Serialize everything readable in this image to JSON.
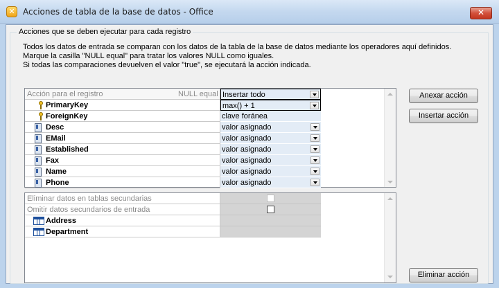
{
  "window": {
    "title": "Acciones de tabla de la base de datos - Office",
    "icon": "app-icon",
    "close_label": "✕"
  },
  "group": {
    "title": "Acciones que se deben ejecutar para cada registro",
    "description": [
      "Todos los datos de entrada se comparan con los datos de la tabla de la base de datos mediante los operadores aquí definidos.",
      "Marque la casilla \"NULL equal\" para tratar los valores NULL como iguales.",
      "Si todas las comparaciones devuelven el valor \"true\", se ejecutará la acción indicada."
    ]
  },
  "action_grid": {
    "header": {
      "label": "Acción para el registro",
      "null_equal": "NULL equal",
      "action_value": "Insertar todo"
    },
    "rows": [
      {
        "icon": "key-icon",
        "name": "PrimaryKey",
        "value": "max() + 1",
        "dropdown": true
      },
      {
        "icon": "key-icon",
        "name": "ForeignKey",
        "value": "clave foránea",
        "dropdown": false
      },
      {
        "icon": "field-icon",
        "name": "Desc",
        "value": "valor asignado",
        "dropdown": true
      },
      {
        "icon": "field-icon",
        "name": "EMail",
        "value": "valor asignado",
        "dropdown": true
      },
      {
        "icon": "field-icon",
        "name": "Established",
        "value": "valor asignado",
        "dropdown": true
      },
      {
        "icon": "field-icon",
        "name": "Fax",
        "value": "valor asignado",
        "dropdown": true
      },
      {
        "icon": "field-icon",
        "name": "Name",
        "value": "valor asignado",
        "dropdown": true
      },
      {
        "icon": "field-icon",
        "name": "Phone",
        "value": "valor asignado",
        "dropdown": true
      }
    ]
  },
  "secondary_grid": {
    "delete_secondary_label": "Eliminar datos en tablas secundarias",
    "delete_secondary_checked": false,
    "delete_secondary_enabled": false,
    "omit_secondary_label": "Omitir datos secundarios de entrada",
    "omit_secondary_checked": false,
    "omit_secondary_enabled": true,
    "tables": [
      {
        "icon": "table-icon",
        "name": "Address"
      },
      {
        "icon": "table-icon",
        "name": "Department"
      }
    ]
  },
  "buttons": {
    "append_action": "Anexar acción",
    "insert_action": "Insertar acción",
    "delete_action": "Eliminar acción"
  }
}
